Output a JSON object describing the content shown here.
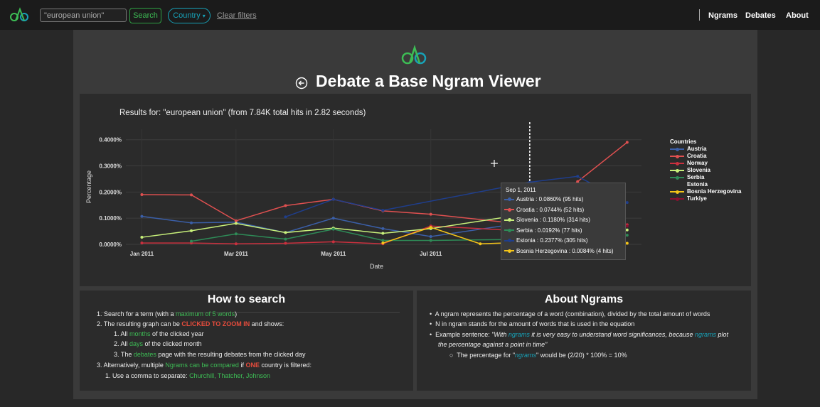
{
  "nav": {
    "search_value": "\"european union\"",
    "search_label": "Search",
    "country_label": "Country",
    "clear_label": "Clear filters",
    "links": [
      "Ngrams",
      "Debates",
      "About"
    ]
  },
  "page": {
    "title": "Debate a Base Ngram Viewer",
    "results": "Results for: \"european union\" (from 7.84K total hits in 2.82 seconds)"
  },
  "chart_data": {
    "type": "line",
    "xlabel": "Date",
    "ylabel": "Percentage",
    "x_ticks": [
      "Jan 2011",
      "Mar 2011",
      "May 2011",
      "Jul 2011",
      "Sep 2"
    ],
    "y_ticks": [
      "0.0000%",
      "0.1000%",
      "0.2000%",
      "0.3000%",
      "0.4000%"
    ],
    "ylim": [
      0,
      0.44
    ],
    "legend_title": "Countries",
    "legend_position": "right",
    "grid": true,
    "series": [
      {
        "name": "Austria",
        "color": "#3b5fa8",
        "x": [
          "2011-01-01",
          "2011-02-01",
          "2011-03-01",
          "2011-04-01",
          "2011-05-01",
          "2011-06-01",
          "2011-07-01",
          "2011-09-01"
        ],
        "values": [
          0.107,
          0.082,
          0.085,
          0.045,
          0.1,
          0.06,
          0.03,
          0.086
        ]
      },
      {
        "name": "Croatia",
        "color": "#e05050",
        "x": [
          "2011-01-01",
          "2011-02-01",
          "2011-03-01",
          "2011-04-01",
          "2011-05-01",
          "2011-06-01",
          "2011-07-01",
          "2011-09-01",
          "2011-10-01",
          "2011-11-01"
        ],
        "values": [
          0.19,
          0.189,
          0.09,
          0.148,
          0.172,
          0.128,
          0.115,
          0.0744,
          0.24,
          0.39
        ]
      },
      {
        "name": "Norway",
        "color": "#c9303e",
        "x": [
          "2011-01-01",
          "2011-02-01",
          "2011-03-01",
          "2011-04-01",
          "2011-05-01",
          "2011-06-01",
          "2011-07-01",
          "2011-09-01",
          "2011-11-01"
        ],
        "values": [
          0.005,
          0.005,
          0.002,
          0.004,
          0.01,
          0.002,
          0.07,
          0.05,
          0.075
        ]
      },
      {
        "name": "Slovenia",
        "color": "#c8f07a",
        "x": [
          "2011-01-01",
          "2011-02-01",
          "2011-03-01",
          "2011-04-01",
          "2011-05-01",
          "2011-06-01",
          "2011-07-01",
          "2011-09-01",
          "2011-11-01"
        ],
        "values": [
          0.027,
          0.052,
          0.08,
          0.045,
          0.062,
          0.042,
          0.06,
          0.118,
          0.055
        ]
      },
      {
        "name": "Serbia",
        "color": "#2e8b57",
        "x": [
          "2011-02-01",
          "2011-03-01",
          "2011-04-01",
          "2011-05-01",
          "2011-06-01",
          "2011-07-01",
          "2011-09-01",
          "2011-11-01"
        ],
        "values": [
          0.012,
          0.04,
          0.02,
          0.058,
          0.015,
          0.015,
          0.0192,
          0.035
        ]
      },
      {
        "name": "Estonia",
        "color": "#1f3e8c",
        "x": [
          "2011-04-01",
          "2011-05-01",
          "2011-06-01",
          "2011-09-01",
          "2011-10-01",
          "2011-11-01"
        ],
        "values": [
          0.105,
          0.172,
          0.13,
          0.2377,
          0.26,
          0.16
        ]
      },
      {
        "name": "Bosnia Herzegovina",
        "color": "#f5c518",
        "x": [
          "2011-06-01",
          "2011-07-01",
          "2011-08-01",
          "2011-09-01",
          "2011-11-01"
        ],
        "values": [
          0.005,
          0.065,
          0.002,
          0.0084,
          0.004
        ]
      },
      {
        "name": "Turkiye",
        "color": "#8b1030",
        "x": [
          "2011-11-01"
        ],
        "values": [
          0.07
        ]
      }
    ],
    "tooltip": {
      "date": "Sep 1, 2011",
      "rows": [
        {
          "label": "Austria : 0.0860% (95 hits)",
          "color": "#3b5fa8"
        },
        {
          "label": "Croatia : 0.0744% (52 hits)",
          "color": "#e05050"
        },
        {
          "label": "Slovenia : 0.1180% (314 hits)",
          "color": "#c8f07a"
        },
        {
          "label": "Serbia : 0.0192% (77 hits)",
          "color": "#2e8b57"
        },
        {
          "label": "Estonia : 0.2377% (305 hits)",
          "color": "#1f3e8c"
        },
        {
          "label": "Bosnia Herzegovina : 0.0084% (4 hits)",
          "color": "#f5c518"
        }
      ]
    }
  },
  "howto": {
    "title": "How to search",
    "l1a": "1. Search for a term (with a ",
    "l1b": "maximum of 5 words",
    "l1c": ")",
    "l2a": "2. The resulting graph can be ",
    "l2b": "CLICKED TO ZOOM IN",
    "l2c": " and shows:",
    "l3a": "1. All ",
    "l3b": "months",
    "l3c": " of the clicked year",
    "l4a": "2. All ",
    "l4b": "days",
    "l4c": " of the clicked month",
    "l5a": "3. The ",
    "l5b": "debates",
    "l5c": " page with the resulting debates from the clicked day",
    "l6a": "3. Alternatively, multiple ",
    "l6b": "Ngrams can be compared",
    "l6c": " if ",
    "l6d": "ONE",
    "l6e": " country is filtered:",
    "l7a": "1. Use a comma to separate: ",
    "l7b": "Churchill, Thatcher, Johnson"
  },
  "about": {
    "title": "About Ngrams",
    "b1": "A ngram represents the percentage of a word (combination), divided by the total amount of words",
    "b2": "N in ngram stands for the amount of words that is used in the equation",
    "b3a": "Example sentence: ",
    "b3b": "\"With ",
    "b3c": "ngrams",
    "b3d": " it is very easy to understand word significances, because ",
    "b3e": "ngrams",
    "b3f": " plot",
    "b3g": "the percentage against a point in time\"",
    "b4a": "The percentage for \"",
    "b4b": "ngrams",
    "b4c": "\" would be (2/20) * 100% = 10%"
  }
}
